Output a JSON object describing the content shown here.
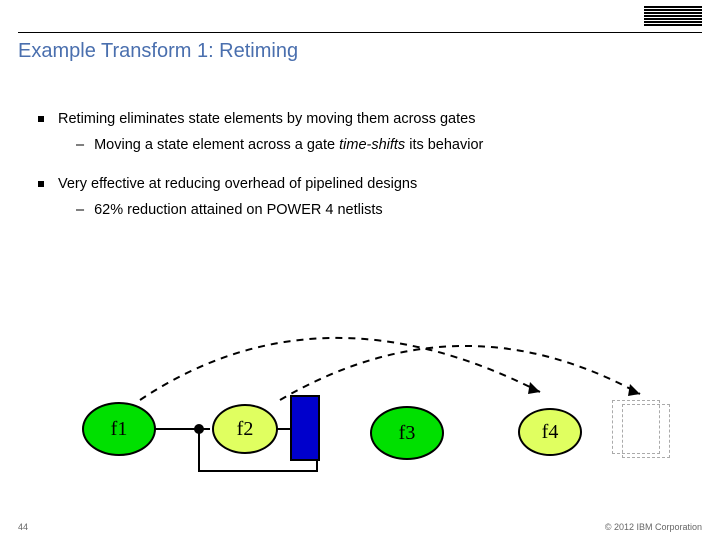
{
  "header": {
    "logo_name": "ibm-logo"
  },
  "title": "Example Transform 1: Retiming",
  "bullets": {
    "b1": "Retiming eliminates state elements by moving them across gates",
    "b1sub_pre": "Moving a state element across a gate ",
    "b1sub_em": "time-shifts",
    "b1sub_post": " its behavior",
    "b2": "Very effective at reducing overhead of pipelined designs",
    "b2sub": "62% reduction attained on POWER 4 netlists"
  },
  "diagram": {
    "nodes": {
      "f1": "f1",
      "f2": "f2",
      "f3": "f3",
      "f4": "f4"
    }
  },
  "footer": {
    "page": "44",
    "copyright": "© 2012 IBM Corporation"
  }
}
